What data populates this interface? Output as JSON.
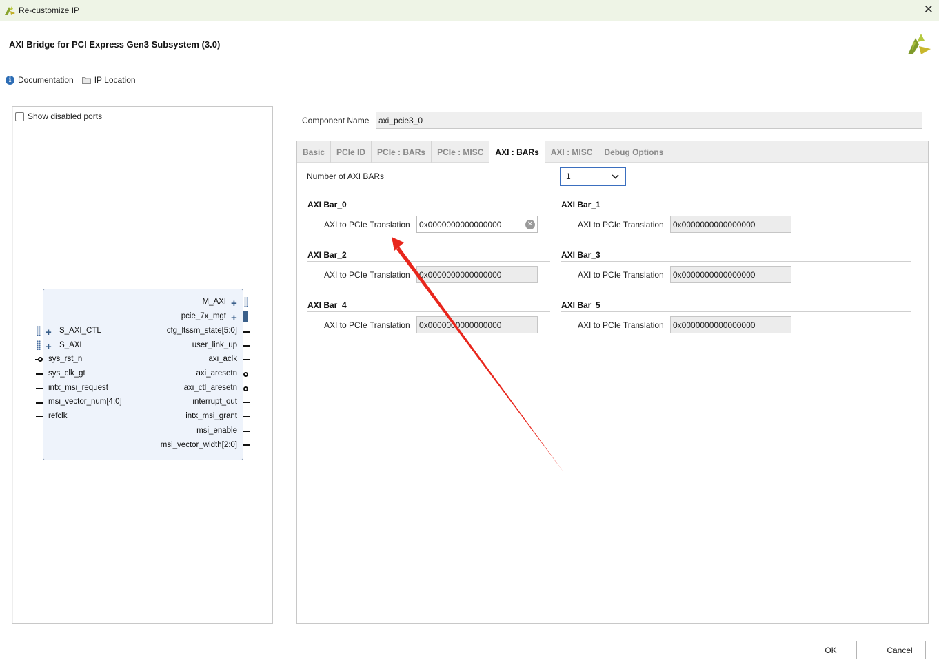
{
  "window": {
    "title": "Re-customize IP",
    "close_glyph": "✕"
  },
  "header": {
    "title": "AXI Bridge for PCI Express Gen3 Subsystem (3.0)"
  },
  "links": {
    "documentation": "Documentation",
    "ip_location": "IP Location"
  },
  "left": {
    "show_disabled_label": "Show disabled ports",
    "show_disabled_checked": false,
    "ports_right": [
      "M_AXI",
      "pcie_7x_mgt",
      "cfg_ltssm_state[5:0]",
      "user_link_up",
      "axi_aclk",
      "axi_aresetn",
      "axi_ctl_aresetn",
      "interrupt_out",
      "intx_msi_grant",
      "msi_enable",
      "msi_vector_width[2:0]"
    ],
    "ports_left": [
      "S_AXI_CTL",
      "S_AXI",
      "sys_rst_n",
      "sys_clk_gt",
      "intx_msi_request",
      "msi_vector_num[4:0]",
      "refclk"
    ]
  },
  "component": {
    "label": "Component Name",
    "value": "axi_pcie3_0"
  },
  "tabs": [
    {
      "label": "Basic",
      "active": false
    },
    {
      "label": "PCIe ID",
      "active": false
    },
    {
      "label": "PCIe : BARs",
      "active": false
    },
    {
      "label": "PCIe : MISC",
      "active": false
    },
    {
      "label": "AXI : BARs",
      "active": true
    },
    {
      "label": "AXI : MISC",
      "active": false
    },
    {
      "label": "Debug Options",
      "active": false
    }
  ],
  "axi_bars": {
    "count_label": "Number of AXI BARs",
    "count_value": "1",
    "bars": [
      {
        "title": "AXI Bar_0",
        "field_label": "AXI to PCIe Translation",
        "value": "0x0000000000000000",
        "enabled": true
      },
      {
        "title": "AXI Bar_1",
        "field_label": "AXI to PCIe Translation",
        "value": "0x0000000000000000",
        "enabled": false
      },
      {
        "title": "AXI Bar_2",
        "field_label": "AXI to PCIe Translation",
        "value": "0x0000000000000000",
        "enabled": false
      },
      {
        "title": "AXI Bar_3",
        "field_label": "AXI to PCIe Translation",
        "value": "0x0000000000000000",
        "enabled": false
      },
      {
        "title": "AXI Bar_4",
        "field_label": "AXI to PCIe Translation",
        "value": "0x0000000000000000",
        "enabled": false
      },
      {
        "title": "AXI Bar_5",
        "field_label": "AXI to PCIe Translation",
        "value": "0x0000000000000000",
        "enabled": false
      }
    ]
  },
  "buttons": {
    "ok": "OK",
    "cancel": "Cancel"
  },
  "colors": {
    "accent": "#3b6fbf",
    "annotation_arrow": "#e8261c",
    "block_fill": "#eef3fb"
  }
}
